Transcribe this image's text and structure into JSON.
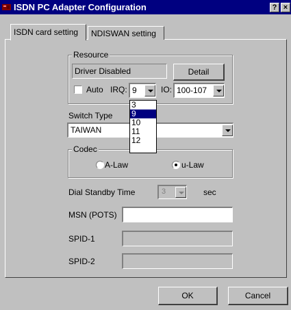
{
  "window": {
    "title": "ISDN PC Adapter Configuration",
    "help_button": "?",
    "close_button": "×"
  },
  "tabs": [
    {
      "label": "ISDN card setting",
      "active": true
    },
    {
      "label": "NDISWAN setting",
      "active": false
    }
  ],
  "resource": {
    "group_label": "Resource",
    "driver_status": "Driver Disabled",
    "detail_button": "Detail",
    "auto_label": "Auto",
    "auto_checked": false,
    "irq_label": "IRQ:",
    "irq_value": "9",
    "irq_options": [
      "3",
      "9",
      "10",
      "11",
      "12"
    ],
    "irq_selected_option": "9",
    "io_label": "IO:",
    "io_value": "100-107"
  },
  "switch_type": {
    "label": "Switch Type",
    "value": "TAIWAN"
  },
  "codec": {
    "group_label": "Codec",
    "options": [
      {
        "label": "A-Law",
        "selected": false
      },
      {
        "label": "u-Law",
        "selected": true
      }
    ]
  },
  "dial_standby": {
    "label": "Dial Standby Time",
    "value": "3",
    "unit": "sec"
  },
  "msn": {
    "label": "MSN (POTS)",
    "value": ""
  },
  "spid1": {
    "label": "SPID-1",
    "value": ""
  },
  "spid2": {
    "label": "SPID-2",
    "value": ""
  },
  "buttons": {
    "ok": "OK",
    "cancel": "Cancel"
  },
  "colors": {
    "titlebar": "#000080",
    "face": "#c0c0c0",
    "selection": "#000080"
  }
}
